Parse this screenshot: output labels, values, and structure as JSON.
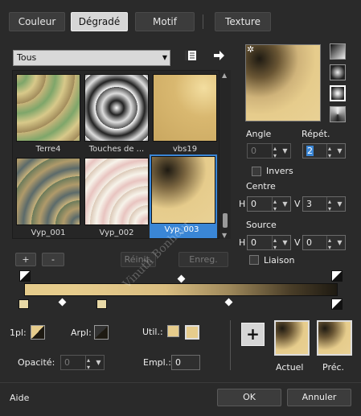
{
  "tabs": [
    {
      "label": "Couleur",
      "active": false
    },
    {
      "label": "Dégradé",
      "active": true
    },
    {
      "label": "Motif",
      "active": false
    },
    {
      "label": "Texture",
      "active": false
    }
  ],
  "category": {
    "selected": "Tous"
  },
  "gallery": {
    "items": [
      {
        "label": "Terre4"
      },
      {
        "label": "Touches de ..."
      },
      {
        "label": "vbs19"
      },
      {
        "label": "Vyp_001"
      },
      {
        "label": "Vyp_002"
      },
      {
        "label": "Vyp_003",
        "selected": true
      }
    ]
  },
  "gallery_buttons": {
    "add": "+",
    "remove": "-",
    "reset": "Réinit.",
    "save": "Enreg."
  },
  "angle": {
    "label": "Angle",
    "value": "0"
  },
  "repeat": {
    "label": "Répét.",
    "value": "2"
  },
  "invert": {
    "label": "Invers",
    "checked": false
  },
  "center": {
    "label": "Centre",
    "h_label": "H",
    "h_value": "0",
    "v_label": "V",
    "v_value": "3"
  },
  "source": {
    "label": "Source",
    "h_label": "H",
    "h_value": "0",
    "v_label": "V",
    "v_value": "0"
  },
  "link": {
    "label": "Liaison",
    "checked": false
  },
  "bottom": {
    "fg_label": "1pl:",
    "bg_label": "Arpl:",
    "user_label": "Util.:",
    "opacity_label": "Opacité:",
    "opacity_value": "0",
    "location_label": "Empl.:",
    "location_value": "0",
    "add_button": "+",
    "current_label": "Actuel",
    "previous_label": "Préc."
  },
  "footer": {
    "help": "Aide",
    "ok": "OK",
    "cancel": "Annuler"
  },
  "watermark": "Vinuth Bonheur",
  "colors": {
    "gold": "#e6cc8c",
    "dark": "#1e1a12",
    "accent": "#3a86d6"
  }
}
